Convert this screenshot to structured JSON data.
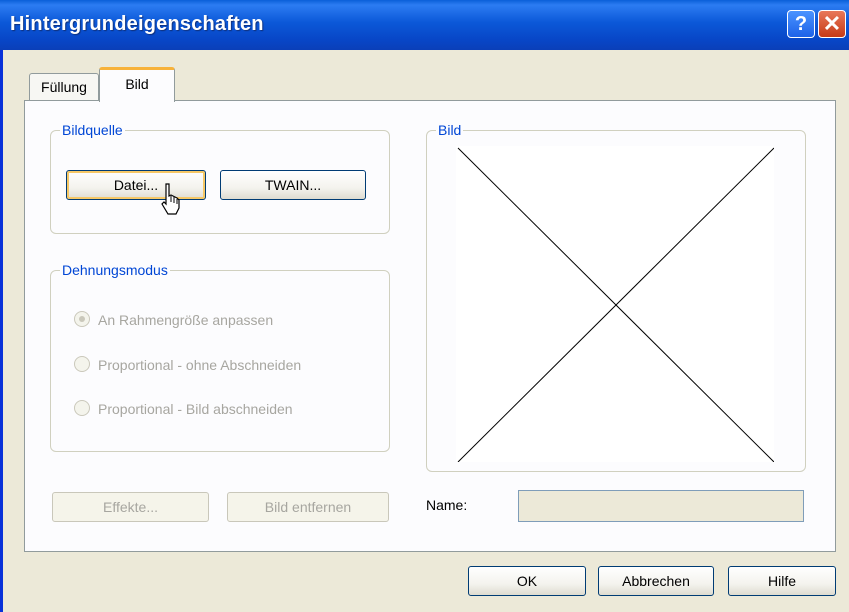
{
  "window": {
    "title": "Hintergrundeigenschaften",
    "help_icon": "question-mark",
    "close_icon": "close-x"
  },
  "tabs": [
    {
      "label": "Füllung",
      "active": false
    },
    {
      "label": "Bild",
      "active": true
    }
  ],
  "bildquelle": {
    "label": "Bildquelle",
    "datei_button": "Datei...",
    "twain_button": "TWAIN..."
  },
  "dehnungsmodus": {
    "label": "Dehnungsmodus",
    "options": [
      {
        "label": "An Rahmengröße anpassen",
        "selected": true
      },
      {
        "label": "Proportional - ohne Abschneiden",
        "selected": false
      },
      {
        "label": "Proportional - Bild abschneiden",
        "selected": false
      }
    ]
  },
  "bild_group": {
    "label": "Bild",
    "preview_icon": "empty-image-cross"
  },
  "lower_buttons": {
    "effekte": "Effekte...",
    "bild_entfernen": "Bild entfernen"
  },
  "name_field": {
    "label": "Name:",
    "value": ""
  },
  "dialog_buttons": {
    "ok": "OK",
    "abbrechen": "Abbrechen",
    "hilfe": "Hilfe"
  },
  "colors": {
    "titlebar": "#0a4fd0",
    "group_label": "#0046d5",
    "tab_highlight": "#f7b23a",
    "dialog_bg": "#ece9d8"
  }
}
